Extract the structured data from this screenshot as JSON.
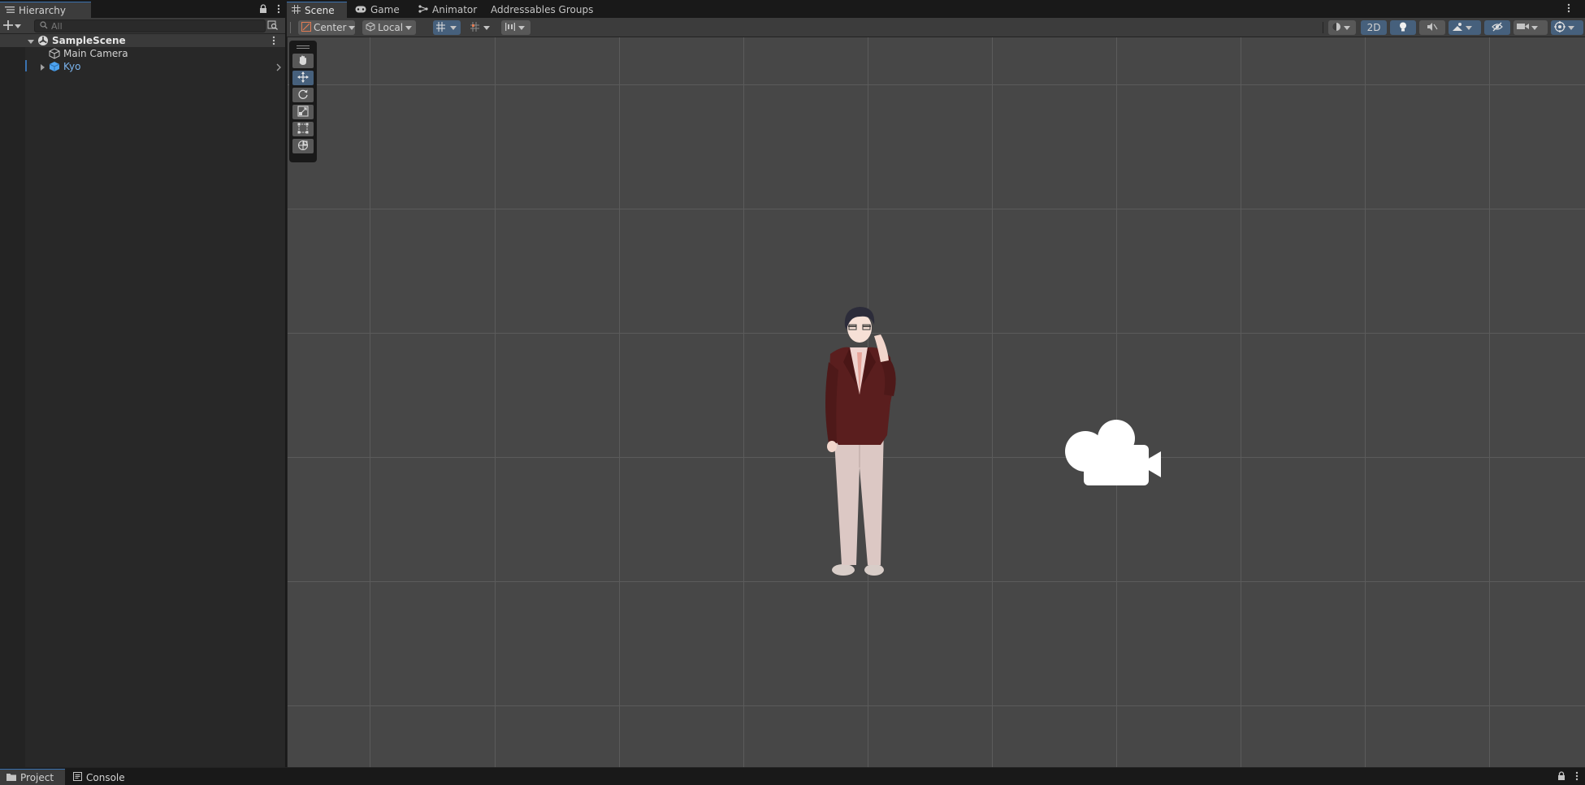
{
  "hierarchy": {
    "tab_label": "Hierarchy",
    "search_placeholder": "All",
    "scene_name": "SampleScene",
    "items": [
      {
        "label": "Main Camera",
        "icon": "gameobject-icon"
      },
      {
        "label": "Kyo",
        "icon": "prefab-icon"
      }
    ]
  },
  "scene_tabs": [
    {
      "label": "Scene",
      "icon": "grid-icon",
      "active": true
    },
    {
      "label": "Game",
      "icon": "gamepad-icon",
      "active": false
    },
    {
      "label": "Animator",
      "icon": "animator-icon",
      "active": false
    },
    {
      "label": "Addressables Groups",
      "icon": "",
      "active": false
    }
  ],
  "scene_toolbar": {
    "pivot_label": "Center",
    "space_label": "Local",
    "mode_2d_label": "2D"
  },
  "bottom_tabs": [
    {
      "label": "Project",
      "icon": "folder-icon",
      "active": true
    },
    {
      "label": "Console",
      "icon": "console-icon",
      "active": false
    }
  ],
  "colors": {
    "accent": "#3a72b0",
    "prefab_text": "#7bb4ee",
    "viewport_bg": "#474747",
    "panel_bg": "#282828"
  }
}
